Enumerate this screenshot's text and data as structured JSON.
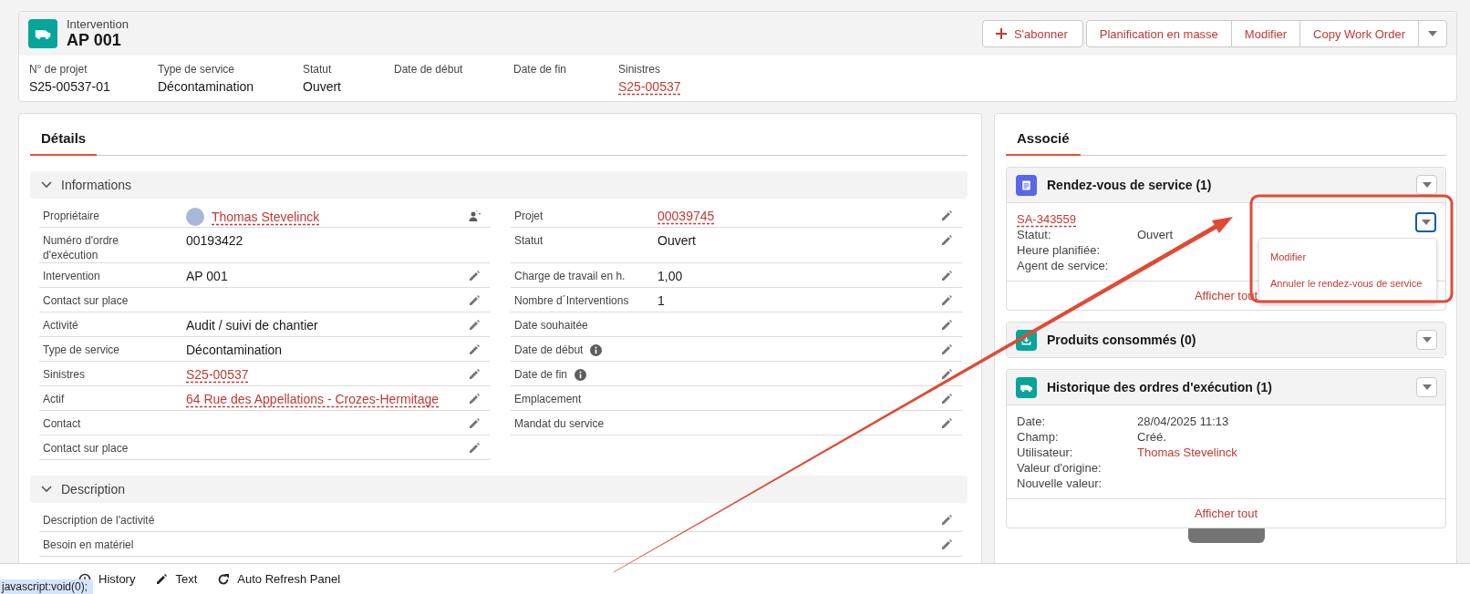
{
  "record_header": {
    "object_type": "Intervention",
    "title": "AP 001",
    "follow_button": "S'abonner",
    "actions": [
      "Planification en masse",
      "Modifier",
      "Copy Work Order"
    ],
    "more_actions": true
  },
  "highlights": [
    {
      "label": "N° de projet",
      "value": "S25-00537-01",
      "kind": "text"
    },
    {
      "label": "Type de service",
      "value": "Décontamination",
      "kind": "text"
    },
    {
      "label": "Statut",
      "value": "Ouvert",
      "kind": "text"
    },
    {
      "label": "Date de début"
    },
    {
      "label": "Date de fin"
    },
    {
      "label": "Sinistres",
      "value": "S25-00537",
      "kind": "link"
    }
  ],
  "details": {
    "tabs": [
      {
        "label": "Détails",
        "selected": true
      }
    ],
    "sections": [
      {
        "title": "Informations",
        "expanded": true,
        "columns": [
          [
            {
              "label": "Propriétaire",
              "value": "Thomas Stevelinck",
              "kind": "owner",
              "info": false,
              "editable": true
            },
            {
              "label": "Numéro d'ordre d'exécution",
              "value": "00193422",
              "kind": "text",
              "info": false,
              "editable": false
            },
            {
              "label": "Intervention",
              "value": "AP 001",
              "kind": "text",
              "info": false,
              "editable": true
            },
            {
              "label": "Contact sur place",
              "info": false,
              "editable": true
            },
            {
              "label": "Activité",
              "value": "Audit / suivi de chantier",
              "kind": "text",
              "info": false,
              "editable": true
            },
            {
              "label": "Type de service",
              "value": "Décontamination",
              "kind": "text",
              "info": false,
              "editable": true
            },
            {
              "label": "Sinistres",
              "value": "S25-00537",
              "kind": "link",
              "info": false,
              "editable": true
            },
            {
              "label": "Actif",
              "value": "64 Rue des Appellations - Crozes-Hermitage",
              "kind": "link",
              "info": false,
              "editable": true
            },
            {
              "label": "Contact",
              "info": false,
              "editable": true
            },
            {
              "label": "Contact sur place",
              "info": false,
              "editable": true
            }
          ],
          [
            {
              "label": "Projet",
              "value": "00039745",
              "kind": "link",
              "info": false,
              "editable": true
            },
            {
              "label": "Statut",
              "value": "Ouvert",
              "kind": "text",
              "info": false,
              "editable": true
            },
            {
              "label": "Charge de travail en h.",
              "value": "1,00",
              "kind": "text",
              "info": false,
              "editable": true
            },
            {
              "label": "Nombre d´Interventions",
              "value": "1",
              "kind": "text",
              "info": false,
              "editable": true
            },
            {
              "label": "Date souhaitée",
              "info": false,
              "editable": true
            },
            {
              "label": "Date de début",
              "info": true,
              "editable": true
            },
            {
              "label": "Date de fin",
              "info": true,
              "editable": true
            },
            {
              "label": "Emplacement",
              "info": false,
              "editable": true
            },
            {
              "label": "Mandat du service",
              "info": false,
              "editable": true
            }
          ]
        ]
      },
      {
        "title": "Description",
        "expanded": true,
        "columns": [
          [
            {
              "label": "Description de l'activité",
              "info": false,
              "editable": true
            },
            {
              "label": "Besoin en matériel",
              "info": false,
              "editable": true
            }
          ]
        ]
      }
    ]
  },
  "related": {
    "tabs": [
      {
        "label": "Associé",
        "selected": true
      }
    ],
    "cards": [
      {
        "title": "Rendez-vous de service (1)",
        "color": "#5867e8",
        "kind": "calendar",
        "records": [
          {
            "link": "SA-343559",
            "menu_open": true,
            "menu": [
              "Modifier",
              "Annuler le rendez-vous de service"
            ],
            "fields": [
              {
                "label": "Statut:",
                "value": "Ouvert",
                "kind": "text"
              },
              {
                "label": "Heure planifiée:"
              },
              {
                "label": "Agent de service:"
              }
            ]
          }
        ],
        "footer": "Afficher tout"
      },
      {
        "title": "Produits consommés (0)",
        "color": "#06a59a",
        "kind": "download"
      },
      {
        "title": "Historique des ordres d'exécution (1)",
        "color": "#06a59a",
        "kind": "van",
        "records": [
          {
            "fields": [
              {
                "label": "Date:",
                "value": "28/04/2025 11:13",
                "kind": "text"
              },
              {
                "label": "Champ:",
                "value": "Créé.",
                "kind": "text"
              },
              {
                "label": "Utilisateur:",
                "value": "Thomas Stevelinck",
                "kind": "user"
              },
              {
                "label": "Valeur d'origine:"
              },
              {
                "label": "Nouvelle valeur:"
              }
            ]
          }
        ],
        "footer": "Afficher tout"
      }
    ]
  },
  "bottom_bar": {
    "tools": [
      {
        "label": "History",
        "kind": "history"
      },
      {
        "label": "Text",
        "kind": "pencil"
      },
      {
        "label": "Auto Refresh Panel",
        "kind": "refresh"
      }
    ],
    "status_url": "javascript:void(0);"
  }
}
